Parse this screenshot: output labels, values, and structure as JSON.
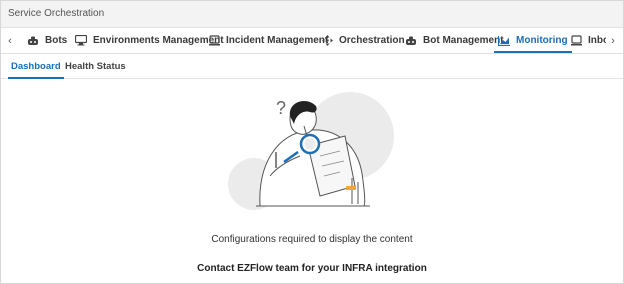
{
  "window": {
    "title": "Service Orchestration"
  },
  "tabs": [
    {
      "label": "Bots",
      "icon": "robot-icon"
    },
    {
      "label": "Environments Management",
      "icon": "monitor-icon"
    },
    {
      "label": "Incident Management",
      "icon": "laptop-icon"
    },
    {
      "label": "Orchestration",
      "icon": "move-arrows-icon"
    },
    {
      "label": "Bot Management",
      "icon": "robot-icon"
    },
    {
      "label": "Monitoring",
      "icon": "chart-icon",
      "active": true
    },
    {
      "label": "Inbo",
      "icon": "laptop-icon"
    }
  ],
  "subtabs": [
    {
      "label": "Dashboard",
      "active": true
    },
    {
      "label": "Health Status"
    }
  ],
  "empty_state": {
    "illustration": "person-with-magnifier-illustration",
    "message": "Configurations required to display the content",
    "cta": "Contact EZFlow team for your INFRA integration"
  },
  "colors": {
    "accent": "#1b6fb8",
    "titlebar": "#f3f3f3"
  }
}
